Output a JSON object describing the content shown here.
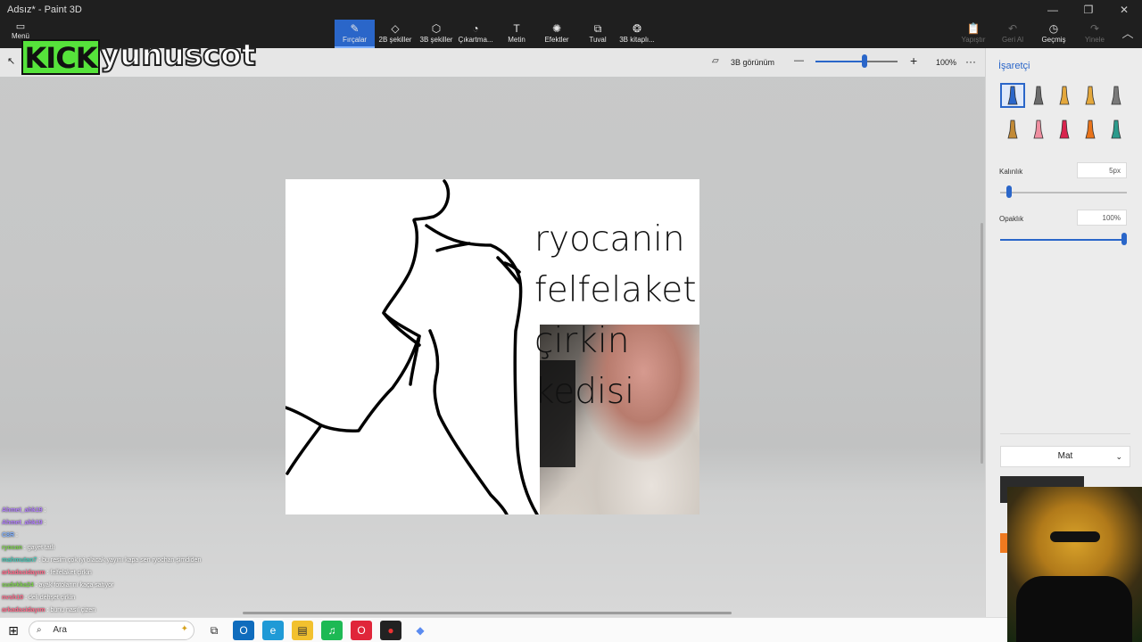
{
  "window": {
    "title": "Adsız* - Paint 3D",
    "controls": [
      "—",
      "❐",
      "✕"
    ]
  },
  "ribbon": {
    "menu_label": "Menü",
    "tools": [
      {
        "label": "Fırçalar",
        "icon": "brush-icon",
        "glyph": "✎",
        "active": true
      },
      {
        "label": "2B şekiller",
        "icon": "shapes-2d-icon",
        "glyph": "◇",
        "active": false
      },
      {
        "label": "3B şekiller",
        "icon": "shapes-3d-icon",
        "glyph": "⬡",
        "active": false
      },
      {
        "label": "Çıkartma...",
        "icon": "sticker-icon",
        "glyph": "◔",
        "active": false
      },
      {
        "label": "Metin",
        "icon": "text-icon",
        "glyph": "T",
        "active": false
      },
      {
        "label": "Efektler",
        "icon": "effects-icon",
        "glyph": "✺",
        "active": false
      },
      {
        "label": "Tuval",
        "icon": "canvas-icon",
        "glyph": "⧉",
        "active": false
      },
      {
        "label": "3B kitaplı...",
        "icon": "library-3d-icon",
        "glyph": "❂",
        "active": false
      }
    ],
    "history": [
      {
        "label": "Yapıştır",
        "icon": "paste-icon",
        "glyph": "📋",
        "enabled": false
      },
      {
        "label": "Geri Al",
        "icon": "undo-icon",
        "glyph": "↶",
        "enabled": false
      },
      {
        "label": "Geçmiş",
        "icon": "history-icon",
        "glyph": "◷",
        "enabled": true
      },
      {
        "label": "Yinele",
        "icon": "redo-icon",
        "glyph": "↷",
        "enabled": false
      }
    ]
  },
  "topbar": {
    "view3d_label": "3B görünüm",
    "zoom": "100%",
    "zoom_level": 0.6,
    "more": "···",
    "minus": "—",
    "plus": "+"
  },
  "canvas": {
    "lines": [
      "ryocanin",
      "felfelaket",
      "çirkin",
      "kedisi"
    ]
  },
  "panel": {
    "title": "İşaretçi",
    "thickness_label": "Kalınlık",
    "thickness_value": "5px",
    "thickness_level": 0.05,
    "opacity_label": "Opaklık",
    "opacity_value": "100%",
    "opacity_level": 1.0,
    "finish": "Mat",
    "brushes": [
      {
        "name": "marker-brush-icon",
        "color": "#2a66c9"
      },
      {
        "name": "calligraphy-pen-icon",
        "color": "#6b6b6b"
      },
      {
        "name": "oil-brush-icon",
        "color": "#e4a83c"
      },
      {
        "name": "watercolor-icon",
        "color": "#e4a83c"
      },
      {
        "name": "pixel-pen-icon",
        "color": "#7a7a7a"
      },
      {
        "name": "pencil-icon",
        "color": "#c28a36"
      },
      {
        "name": "eraser-icon",
        "color": "#ef8fa0"
      },
      {
        "name": "crayon-icon",
        "color": "#d8234d"
      },
      {
        "name": "spray-can-icon",
        "color": "#e9731a"
      },
      {
        "name": "fill-icon",
        "color": "#2c9b8c"
      }
    ]
  },
  "overlay": {
    "kick_logo": "KICK",
    "streamer_name": "yunuscot",
    "chat": [
      {
        "user": "Ahmet_ahk19",
        "color": "#b27cff",
        "msg": ""
      },
      {
        "user": "Ahmet_ahk19",
        "color": "#b27cff",
        "msg": ""
      },
      {
        "user": "C8R",
        "color": "#7fb0ff",
        "msg": ""
      },
      {
        "user": "ryocan",
        "color": "#7ad14a",
        "msg": "gayet tatlı"
      },
      {
        "user": "mahmutan7",
        "color": "#46c9b8",
        "msg": "bu resim çok iyi olacak yayını kapa sen ryochan şimdiden"
      },
      {
        "user": "arkadasidayım",
        "color": "#ff6a8a",
        "msg": "felfelaket çirkin"
      },
      {
        "user": "sudekka24",
        "color": "#7ad14a",
        "msg": "ayak fotolarını kaça satıyor"
      },
      {
        "user": "nvsh10",
        "color": "#ff6a8a",
        "msg": "deli dehşet çirkin"
      },
      {
        "user": "arkadasidayım",
        "color": "#ff6a8a",
        "msg": "bunu nasıl çizen"
      }
    ]
  },
  "taskbar": {
    "search_placeholder": "Ara",
    "apps": [
      {
        "name": "task-view-icon",
        "glyph": "⧉",
        "bg": "#fafafa",
        "fg": "#222"
      },
      {
        "name": "outlook-icon",
        "glyph": "O",
        "bg": "#0f6cbd",
        "fg": "#fff"
      },
      {
        "name": "edge-icon",
        "glyph": "e",
        "bg": "#1f9ad6",
        "fg": "#fff"
      },
      {
        "name": "files-icon",
        "glyph": "▤",
        "bg": "#f2c12e",
        "fg": "#333"
      },
      {
        "name": "spotify-icon",
        "glyph": "♫",
        "bg": "#1db954",
        "fg": "#fff"
      },
      {
        "name": "opera-icon",
        "glyph": "O",
        "bg": "#e0263a",
        "fg": "#fff"
      },
      {
        "name": "app-icon",
        "glyph": "●",
        "bg": "#222",
        "fg": "#e33"
      },
      {
        "name": "paint3d-icon",
        "glyph": "◆",
        "bg": "#fafafa",
        "fg": "#5b8bf0"
      }
    ]
  }
}
